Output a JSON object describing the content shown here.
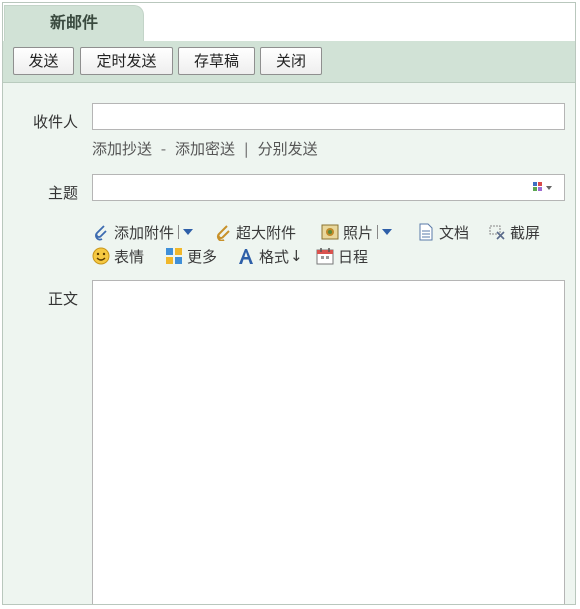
{
  "tab": {
    "title": "新邮件"
  },
  "toolbar": {
    "send": "发送",
    "scheduled_send": "定时发送",
    "save_draft": "存草稿",
    "close": "关闭"
  },
  "recipient": {
    "label": "收件人",
    "value": ""
  },
  "recipient_links": {
    "add_cc": "添加抄送",
    "dash": "-",
    "add_bcc": "添加密送",
    "pipe": "|",
    "separate_send": "分别发送"
  },
  "subject": {
    "label": "主题",
    "value": ""
  },
  "attach_tools": {
    "add_attachment": "添加附件",
    "large_attachment": "超大附件",
    "photo": "照片",
    "document": "文档",
    "screenshot": "截屏",
    "emoji": "表情",
    "more": "更多",
    "format": "格式",
    "schedule": "日程"
  },
  "body": {
    "label": "正文",
    "value": ""
  },
  "icons": {
    "attachment": "paperclip-icon",
    "large_attachment": "large-paperclip-icon",
    "photo": "photo-icon",
    "document": "document-icon",
    "screenshot": "scissors-icon",
    "emoji": "smiley-icon",
    "more": "grid-icon",
    "format": "font-a-icon",
    "schedule": "calendar-icon",
    "subject_picker": "color-grid-icon"
  },
  "colors": {
    "header_green": "#d1e2d6",
    "panel_bg": "#eef5f0",
    "link_blue": "#2e5fa8"
  }
}
